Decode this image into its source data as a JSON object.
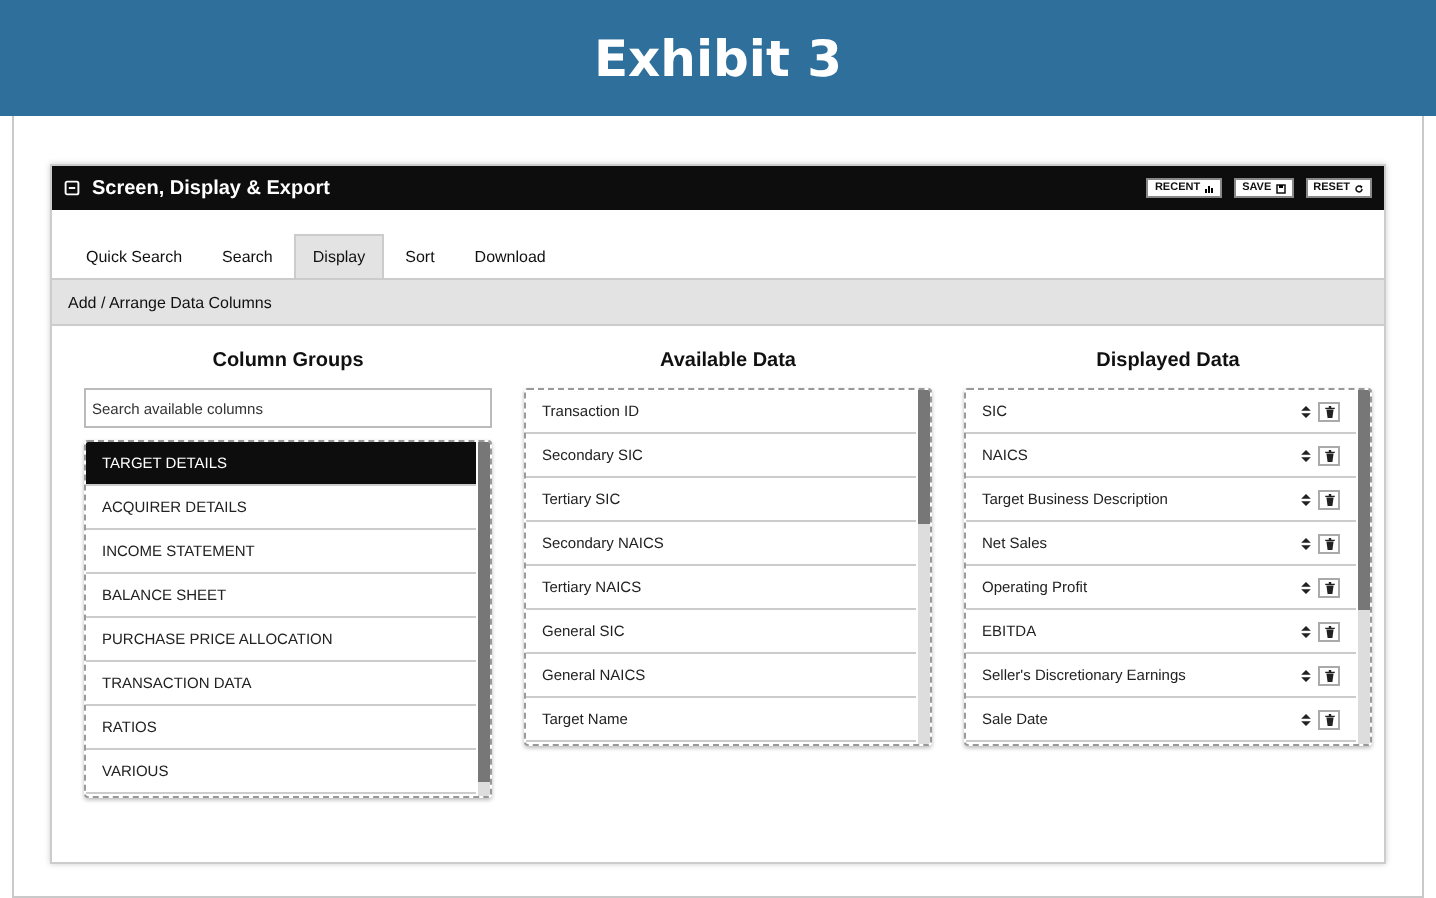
{
  "exhibit": {
    "title": "Exhibit 3"
  },
  "window": {
    "title": "Screen, Display & Export",
    "buttons": [
      "RECENT",
      "SAVE",
      "RESET"
    ]
  },
  "tabs": [
    {
      "label": "Quick Search",
      "selected": false
    },
    {
      "label": "Search",
      "selected": false
    },
    {
      "label": "Display",
      "selected": true
    },
    {
      "label": "Sort",
      "selected": false
    },
    {
      "label": "Download",
      "selected": false
    }
  ],
  "section": {
    "title": "Add / Arrange Data Columns"
  },
  "column_groups": {
    "heading": "Column Groups",
    "search": {
      "placeholder": "Search available columns"
    },
    "items": [
      {
        "label": "TARGET DETAILS",
        "selected": true
      },
      {
        "label": "ACQUIRER DETAILS",
        "selected": false
      },
      {
        "label": "INCOME STATEMENT",
        "selected": false
      },
      {
        "label": "BALANCE SHEET",
        "selected": false
      },
      {
        "label": "PURCHASE PRICE ALLOCATION",
        "selected": false
      },
      {
        "label": "TRANSACTION DATA",
        "selected": false
      },
      {
        "label": "RATIOS",
        "selected": false
      },
      {
        "label": "VARIOUS",
        "selected": false
      }
    ]
  },
  "available_data": {
    "heading": "Available Data",
    "items": [
      "Transaction ID",
      "Secondary SIC",
      "Tertiary SIC",
      "Secondary NAICS",
      "Tertiary NAICS",
      "General SIC",
      "General NAICS",
      "Target Name"
    ]
  },
  "displayed_data": {
    "heading": "Displayed Data",
    "items": [
      "SIC",
      "NAICS",
      "Target Business Description",
      "Net Sales",
      "Operating Profit",
      "EBITDA",
      "Seller's Discretionary Earnings",
      "Sale Date"
    ]
  }
}
